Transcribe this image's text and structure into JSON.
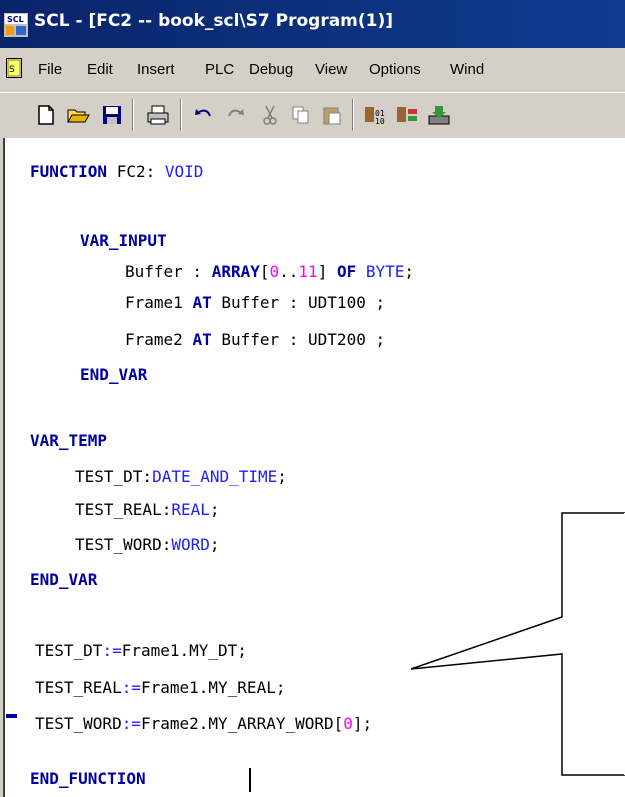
{
  "window": {
    "title": "SCL  - [FC2 -- book_scl\\S7 Program(1)]",
    "app_icon": "scl-app-icon"
  },
  "menu": {
    "doc_icon": "document-icon",
    "items": [
      "File",
      "Edit",
      "Insert",
      "PLC",
      "Debug",
      "View",
      "Options",
      "Wind"
    ]
  },
  "toolbar": {
    "buttons": [
      "new-icon",
      "open-icon",
      "save-icon",
      "print-icon",
      "undo-icon",
      "redo-icon",
      "cut-icon",
      "copy-icon",
      "paste-icon",
      "compile-icon",
      "compile-all-icon",
      "download-icon"
    ]
  },
  "code": {
    "l1": {
      "kw": "FUNCTION",
      "rest": " FC2: ",
      "type": "VOID"
    },
    "l2": {
      "kw": "VAR_INPUT"
    },
    "l3": {
      "a": "Buffer : ",
      "kw": "ARRAY",
      "b": "[",
      "n1": "0",
      "c": "..",
      "n2": "11",
      "d": "] ",
      "kw2": "OF",
      "e": " ",
      "type": "BYTE",
      "f": ";"
    },
    "l4": {
      "a": "Frame1 ",
      "kw": "AT",
      "b": " Buffer : UDT100 ;"
    },
    "l5": {
      "a": "Frame2 ",
      "kw": "AT",
      "b": " Buffer : UDT200 ;"
    },
    "l6": {
      "kw": "END_VAR"
    },
    "l7": {
      "kw": "VAR_TEMP"
    },
    "l8": {
      "a": "TEST_DT:",
      "type": "DATE_AND_TIME",
      "b": ";"
    },
    "l9": {
      "a": "TEST_REAL:",
      "type": "REAL",
      "b": ";"
    },
    "l10": {
      "a": "TEST_WORD:",
      "type": "WORD",
      "b": ";"
    },
    "l11": {
      "kw": "END_VAR"
    },
    "l12": {
      "a": "TEST_DT",
      "op": ":=",
      "b": "Frame1.MY_DT;"
    },
    "l13": {
      "a": "TEST_REAL",
      "op": ":=",
      "b": "Frame1.MY_REAL;"
    },
    "l14": {
      "a": "TEST_WORD",
      "op": ":=",
      "b": "Frame2.MY_ARRAY_WORD[",
      "n": "0",
      "c": "];"
    },
    "l15": {
      "kw": "END_FUNCTION"
    }
  }
}
